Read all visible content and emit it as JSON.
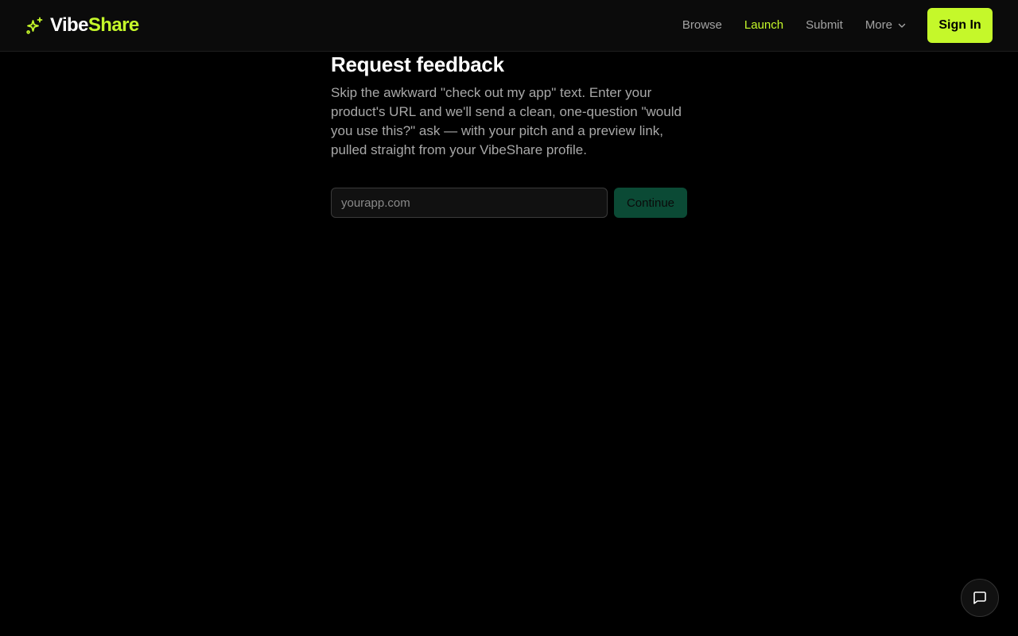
{
  "brand": {
    "name_part1": "Vibe",
    "name_part2": "Share",
    "icon": "sparkles-icon",
    "accent_color": "#c5f82a"
  },
  "nav": {
    "links": [
      {
        "label": "Browse",
        "active": false
      },
      {
        "label": "Launch",
        "active": true
      },
      {
        "label": "Submit",
        "active": false
      }
    ],
    "more_label": "More",
    "more_icon": "chevron-down-icon",
    "sign_in_label": "Sign In"
  },
  "main": {
    "title": "Request feedback",
    "description": "Skip the awkward \"check out my app\" text. Enter your product's URL and we'll send a clean, one-question \"would you use this?\" ask — with your pitch and a preview link, pulled straight from your VibeShare profile.",
    "url_placeholder": "yourapp.com",
    "url_value": "",
    "continue_label": "Continue",
    "continue_color": "#0b4a35"
  },
  "chat": {
    "icon": "chat-bubble-icon"
  }
}
